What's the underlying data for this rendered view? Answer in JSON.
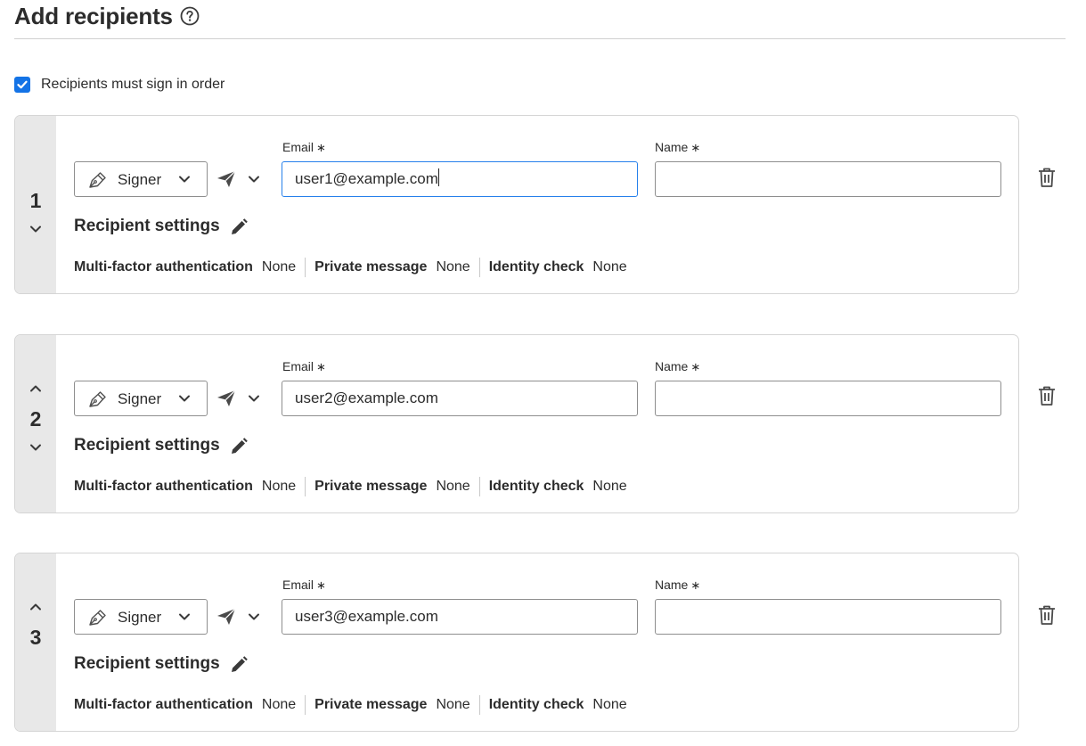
{
  "header": {
    "title": "Add recipients",
    "help_icon": "help-circle-icon"
  },
  "order": {
    "checked": true,
    "label": "Recipients must sign in order"
  },
  "field_labels": {
    "email": "Email",
    "name": "Name",
    "required_mark": "∗"
  },
  "settings": {
    "title": "Recipient settings",
    "mfa_label": "Multi-factor authentication",
    "private_message_label": "Private message",
    "identity_check_label": "Identity check"
  },
  "recipients": [
    {
      "number": "1",
      "role": "Signer",
      "email": "user1@example.com",
      "name": "",
      "mfa": "None",
      "private_message": "None",
      "identity_check": "None"
    },
    {
      "number": "2",
      "role": "Signer",
      "email": "user2@example.com",
      "name": "",
      "mfa": "None",
      "private_message": "None",
      "identity_check": "None"
    },
    {
      "number": "3",
      "role": "Signer",
      "email": "user3@example.com",
      "name": "",
      "mfa": "None",
      "private_message": "None",
      "identity_check": "None"
    }
  ],
  "colors": {
    "accent": "#1473e6",
    "focus_border": "#2680eb",
    "number_column": "#e8e8e8",
    "text": "#2c2c2c"
  },
  "icons": [
    "help-circle-icon",
    "checkmark-icon",
    "fountain-pen-icon",
    "chevron-down-icon",
    "paper-plane-icon",
    "chevron-up-icon",
    "pencil-icon",
    "trash-icon"
  ]
}
